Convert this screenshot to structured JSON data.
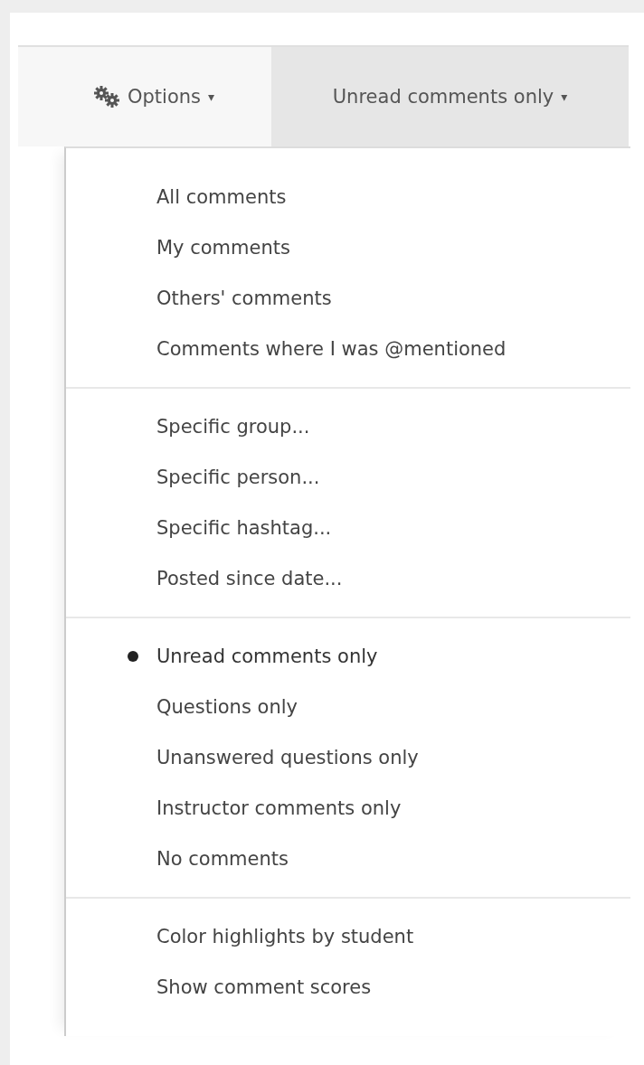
{
  "toolbar": {
    "options_button": {
      "label": "Options",
      "caret": "▾"
    },
    "filter_dropdown": {
      "label": "Unread comments only",
      "caret": "▾"
    }
  },
  "menu": {
    "groups": [
      {
        "items": [
          {
            "label": "All comments",
            "selected": false
          },
          {
            "label": "My comments",
            "selected": false
          },
          {
            "label": "Others' comments",
            "selected": false
          },
          {
            "label": "Comments where I was @mentioned",
            "selected": false
          }
        ]
      },
      {
        "items": [
          {
            "label": "Specific group...",
            "selected": false
          },
          {
            "label": "Specific person...",
            "selected": false
          },
          {
            "label": "Specific hashtag...",
            "selected": false
          },
          {
            "label": "Posted since date...",
            "selected": false
          }
        ]
      },
      {
        "items": [
          {
            "label": "Unread comments only",
            "selected": true
          },
          {
            "label": "Questions only",
            "selected": false
          },
          {
            "label": "Unanswered questions only",
            "selected": false
          },
          {
            "label": "Instructor comments only",
            "selected": false
          },
          {
            "label": "No comments",
            "selected": false
          }
        ]
      },
      {
        "items": [
          {
            "label": "Color highlights by student",
            "selected": false
          },
          {
            "label": "Show comment scores",
            "selected": false
          }
        ]
      }
    ]
  }
}
